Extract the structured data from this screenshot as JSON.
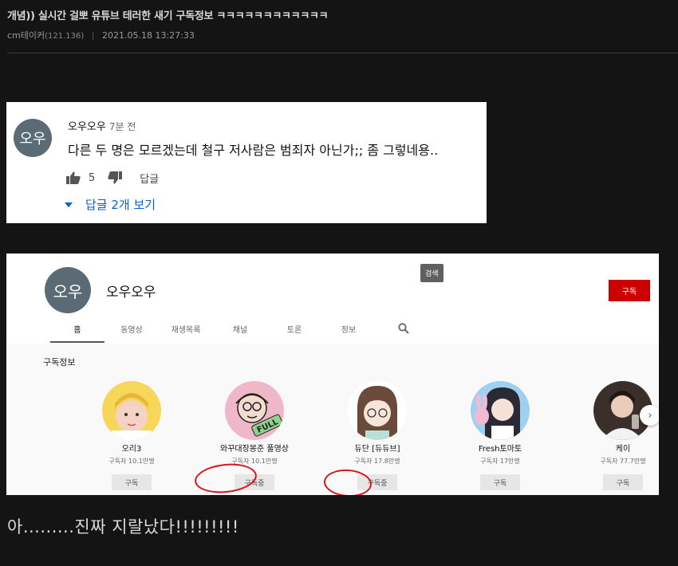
{
  "post": {
    "title": "개념)) 실시간 걸뽀 유튜브 테러한 새기 구독정보 ㅋㅋㅋㅋㅋㅋㅋㅋㅋㅋㅋㅋ",
    "author": "cm테이커",
    "ip": "(121.136)",
    "separator": "|",
    "datetime": "2021.05.18 13:27:33",
    "body": "아.........진짜 지랄났다!!!!!!!!!"
  },
  "comment": {
    "avatar_text": "오우",
    "author": "오우오우",
    "time": "7분 전",
    "text": "다른 두 명은 모르겠는데 철구 저사람은 범죄자 아닌가;; 좀 그렇네용..",
    "likes": "5",
    "reply_label": "답글",
    "view_replies": "답글 2개 보기",
    "accent_color": "#065fd4"
  },
  "channel": {
    "avatar_text": "오우",
    "name": "오우오우",
    "search_tooltip": "검색",
    "subscribe_label": "구독",
    "tabs": [
      "홈",
      "동영상",
      "재생목록",
      "채널",
      "토론",
      "정보"
    ],
    "section_title": "구독정보",
    "subscriptions": [
      {
        "name": "오리3",
        "count": "구독자 10.1만명",
        "button": "구독"
      },
      {
        "name": "와꾸대장봉준 풀영상",
        "count": "구독자 10.1만명",
        "button": "구독중"
      },
      {
        "name": "듀단 [듀듀브]",
        "count": "구독자 17.8만명",
        "button": "구독중"
      },
      {
        "name": "Fresh토마토",
        "count": "구독자 17만명",
        "button": "구독"
      },
      {
        "name": "케이",
        "count": "구독자 77.7만명",
        "button": "구독"
      }
    ],
    "thumb_badge": "FULL",
    "brand_color": "#cc0000"
  }
}
